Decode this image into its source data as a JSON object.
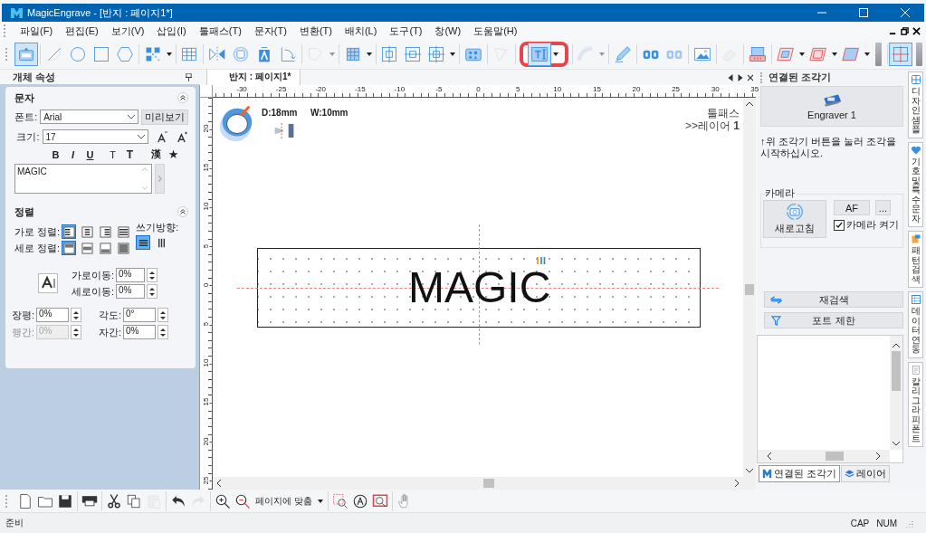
{
  "window": {
    "title": "MagicEngrave - [반지 : 페이지1*]"
  },
  "menu": [
    "파일(F)",
    "편집(E)",
    "보기(V)",
    "삽입(I)",
    "툴패스(T)",
    "문자(T)",
    "변환(T)",
    "배치(L)",
    "도구(T)",
    "창(W)",
    "도움말(H)"
  ],
  "toolbar": [
    [
      {
        "kind": "svg-import",
        "selected": true,
        "disabled": false,
        "dropdown": false,
        "highlighted": false
      }
    ],
    [
      {
        "kind": "line",
        "selected": false,
        "disabled": false,
        "dropdown": false,
        "highlighted": false
      },
      {
        "kind": "circle",
        "selected": false,
        "disabled": false,
        "dropdown": false,
        "highlighted": false
      },
      {
        "kind": "rectangle",
        "selected": false,
        "disabled": false,
        "dropdown": false,
        "highlighted": false
      },
      {
        "kind": "hexagon",
        "selected": false,
        "disabled": false,
        "dropdown": false,
        "highlighted": false
      }
    ],
    [
      {
        "kind": "qr",
        "selected": false,
        "disabled": false,
        "dropdown": true,
        "highlighted": false
      }
    ],
    [
      {
        "kind": "table",
        "selected": false,
        "disabled": false,
        "dropdown": false,
        "highlighted": false
      }
    ],
    [
      {
        "kind": "mirror",
        "selected": false,
        "disabled": false,
        "dropdown": false,
        "highlighted": false
      },
      {
        "kind": "rotate",
        "selected": false,
        "disabled": false,
        "dropdown": false,
        "highlighted": false
      },
      {
        "kind": "fit",
        "selected": false,
        "disabled": false,
        "dropdown": false,
        "highlighted": false
      },
      {
        "kind": "bend",
        "selected": false,
        "disabled": false,
        "dropdown": false,
        "highlighted": false
      }
    ],
    [
      {
        "kind": "shape",
        "selected": false,
        "disabled": true,
        "dropdown": true,
        "highlighted": false
      }
    ],
    [
      {
        "kind": "array",
        "selected": false,
        "disabled": false,
        "dropdown": true,
        "highlighted": false
      }
    ],
    [
      {
        "kind": "align-a",
        "selected": false,
        "disabled": false,
        "dropdown": false,
        "highlighted": false
      },
      {
        "kind": "align-b",
        "selected": false,
        "disabled": false,
        "dropdown": false,
        "highlighted": false
      },
      {
        "kind": "align-c",
        "selected": false,
        "disabled": false,
        "dropdown": true,
        "highlighted": false
      }
    ],
    [
      {
        "kind": "pattern",
        "selected": false,
        "disabled": false,
        "dropdown": false,
        "highlighted": false
      }
    ],
    [
      {
        "kind": "cut",
        "selected": false,
        "disabled": true,
        "dropdown": false,
        "highlighted": false
      }
    ],
    [
      {
        "kind": "text",
        "selected": true,
        "disabled": false,
        "dropdown": true,
        "highlighted": true
      }
    ],
    [
      {
        "kind": "arc-text",
        "selected": false,
        "disabled": true,
        "dropdown": true,
        "highlighted": false
      }
    ],
    [
      {
        "kind": "pencil",
        "selected": false,
        "disabled": false,
        "dropdown": false,
        "highlighted": false
      }
    ],
    [
      {
        "kind": "outline",
        "selected": false,
        "disabled": false,
        "dropdown": false,
        "highlighted": false
      },
      {
        "kind": "outline",
        "selected": false,
        "disabled": true,
        "dropdown": false,
        "highlighted": false
      }
    ],
    [
      {
        "kind": "image",
        "selected": false,
        "disabled": false,
        "dropdown": false,
        "highlighted": false
      }
    ],
    [
      {
        "kind": "eraser",
        "selected": false,
        "disabled": true,
        "dropdown": false,
        "highlighted": false
      }
    ],
    [
      {
        "kind": "machine",
        "selected": false,
        "disabled": false,
        "dropdown": false,
        "highlighted": false
      }
    ],
    [
      {
        "kind": "frame-a",
        "selected": false,
        "disabled": false,
        "dropdown": true,
        "highlighted": false
      },
      {
        "kind": "frame-b",
        "selected": false,
        "disabled": false,
        "dropdown": true,
        "highlighted": false
      },
      {
        "kind": "frame-c",
        "selected": false,
        "disabled": false,
        "dropdown": true,
        "highlighted": false
      }
    ],
    [
      {
        "kind": "crosshair",
        "selected": true,
        "disabled": false,
        "dropdown": false,
        "highlighted": false
      }
    ]
  ],
  "properties": {
    "title": "개체 속성",
    "text_section": {
      "title": "문자",
      "expanded": true,
      "font_label": "폰트:",
      "font": "Arial",
      "preview_button": "미리보기",
      "size_label": "크기:",
      "size": "17",
      "format_buttons": [
        {
          "label": "B",
          "kind": "bold"
        },
        {
          "label": "I",
          "kind": "italic"
        },
        {
          "label": "U",
          "kind": "underline"
        },
        {
          "label": "T",
          "kind": "plain"
        },
        {
          "label": "T",
          "kind": "heavy"
        },
        {
          "label": "漢",
          "kind": "hanja"
        },
        {
          "label": "★",
          "kind": "symbol"
        }
      ],
      "text": "MAGIC"
    },
    "align_section": {
      "title": "정렬",
      "expanded": true,
      "horizontal_label": "가로 정렬:",
      "horizontal_options": [
        {
          "selected": true
        },
        {
          "selected": false
        },
        {
          "selected": false
        },
        {
          "selected": false
        }
      ],
      "vertical_label": "세로 정렬:",
      "vertical_options": [
        {
          "selected": true
        },
        {
          "selected": false
        },
        {
          "selected": false
        },
        {
          "selected": false
        }
      ],
      "direction_label": "쓰기방향:",
      "direction_options": [
        {
          "selected": true
        },
        {
          "selected": false
        }
      ],
      "offset_fields": [
        {
          "label": "가로이동:",
          "value": "0%",
          "disabled": false
        },
        {
          "label": "세로이동:",
          "value": "0%",
          "disabled": false
        }
      ],
      "spacing_fields": [
        {
          "label": "장평:",
          "value": "0%",
          "disabled": false
        },
        {
          "label": "각도:",
          "value": "0°",
          "disabled": false
        },
        {
          "label": "행간:",
          "value": "0%",
          "disabled": true
        },
        {
          "label": "자간:",
          "value": "0%",
          "disabled": false
        }
      ]
    }
  },
  "document": {
    "tab": "반지 : 페이지1*",
    "ruler_h": [
      "-30",
      "-25",
      "-20",
      "-15",
      "-10",
      "-5",
      "0",
      "5",
      "10",
      "15",
      "20",
      "25",
      "30",
      "35"
    ],
    "ruler_v": [
      "20",
      "15",
      "10",
      "5",
      "0",
      "5",
      "10",
      "15",
      "20",
      "25"
    ],
    "diameter": "D:18mm",
    "width": "W:10mm",
    "toolpath": "툴패스",
    "layer": ">>레이어 **1**",
    "object_text": "MAGIC"
  },
  "engraver_panel": {
    "title": "연결된 조각기",
    "engraver_button": "Engraver 1",
    "hint": "↑위 조각기 버튼을 눌러 조각을 시작하십시오.",
    "camera": {
      "title": "카메라",
      "refresh_button": "새로고침",
      "af_button": "AF",
      "more_button": "...",
      "camera_on": {
        "label": "카메라 켜기",
        "checked": true
      }
    },
    "rescan_button": "재검색",
    "port_button": "포트 제한",
    "tabs": [
      {
        "label": "연결된 조각기",
        "selected": true
      },
      {
        "label": "레이어",
        "selected": false
      }
    ]
  },
  "side_tabs": [
    {
      "label": "디자인 샘플",
      "kind": "samples"
    },
    {
      "label": "기호 및 특수문자",
      "kind": "symbols"
    },
    {
      "label": "패턴 검색",
      "kind": "pattern"
    },
    {
      "label": "데이터 연동",
      "kind": "data"
    },
    {
      "label": "칼리그라피 폰트",
      "kind": "font"
    }
  ],
  "bottom_toolbar": [
    [
      {
        "kind": "new",
        "disabled": false
      },
      {
        "kind": "open",
        "disabled": false
      },
      {
        "kind": "save",
        "disabled": false
      }
    ],
    [
      {
        "kind": "print",
        "disabled": false
      }
    ],
    [
      {
        "kind": "cut",
        "disabled": false
      },
      {
        "kind": "copy",
        "disabled": false
      },
      {
        "kind": "paste",
        "disabled": true
      }
    ],
    [
      {
        "kind": "undo",
        "disabled": false
      },
      {
        "kind": "redo",
        "disabled": true
      }
    ],
    [
      {
        "kind": "zoom-in",
        "disabled": false
      },
      {
        "kind": "zoom-out",
        "disabled": false
      },
      {
        "kind": "zoom-select",
        "label": "페이지에 맞춤",
        "disabled": false
      }
    ],
    [
      {
        "kind": "zoom-area",
        "disabled": false
      },
      {
        "kind": "zoom-text",
        "disabled": false
      },
      {
        "kind": "zoom-object",
        "disabled": false
      }
    ],
    [
      {
        "kind": "hand",
        "disabled": false
      }
    ]
  ],
  "status_bar": {
    "text": "준비",
    "indicators": [
      "CAP",
      "NUM"
    ]
  }
}
